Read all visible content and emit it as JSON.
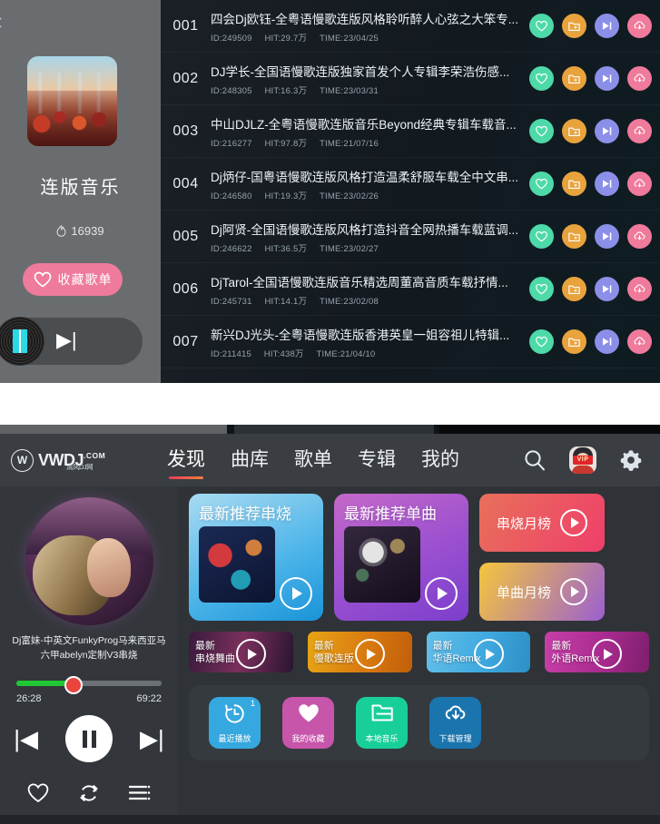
{
  "window1": {
    "back_label": "‹",
    "playlist": {
      "title": "连版音乐",
      "heat_count": "16939",
      "favorite_button": "收藏歌单"
    },
    "tracks": [
      {
        "num": "001",
        "name": "四会Dj欧钰-全粤语慢歌连版风格聆听醉人心弦之大笨专...",
        "id": "ID:249509",
        "hit": "HIT:29.7万",
        "time": "TIME:23/04/25"
      },
      {
        "num": "002",
        "name": "DJ学长-全国语慢歌连版独家首发个人专辑李荣浩伤感...",
        "id": "ID:248305",
        "hit": "HIT:16.3万",
        "time": "TIME:23/03/31"
      },
      {
        "num": "003",
        "name": "中山DJLZ-全粤语慢歌连版音乐Beyond经典专辑车载音...",
        "id": "ID:216277",
        "hit": "HIT:97.8万",
        "time": "TIME:21/07/16"
      },
      {
        "num": "004",
        "name": "Dj炳仔-国粤语慢歌连版风格打造温柔舒服车载全中文串...",
        "id": "ID:246580",
        "hit": "HIT:19.3万",
        "time": "TIME:23/02/26"
      },
      {
        "num": "005",
        "name": "Dj阿贤-全国语慢歌连版风格打造抖音全网热播车载蓝调...",
        "id": "ID:246622",
        "hit": "HIT:36.5万",
        "time": "TIME:23/02/27"
      },
      {
        "num": "006",
        "name": "DjTarol-全国语慢歌连版音乐精选周董高音质车载抒情...",
        "id": "ID:245731",
        "hit": "HIT:14.1万",
        "time": "TIME:23/02/08"
      },
      {
        "num": "007",
        "name": "新兴DJ光头-全粤语慢歌连版香港英皇一姐容祖儿特辑...",
        "id": "ID:211415",
        "hit": "HIT:438万",
        "time": "TIME:21/04/10"
      }
    ],
    "track_action_labels": {
      "favorite": "收藏",
      "add_to_folder": "加入歌单",
      "play_next": "下一首播放",
      "download": "下载"
    }
  },
  "window2": {
    "logo": {
      "mark": "W",
      "text": "VWDJ",
      "com": ".COM",
      "cn": "清风DJ网"
    },
    "tabs": [
      {
        "label": "发现",
        "active": true
      },
      {
        "label": "曲库",
        "active": false
      },
      {
        "label": "歌单",
        "active": false
      },
      {
        "label": "专辑",
        "active": false
      },
      {
        "label": "我的",
        "active": false
      }
    ],
    "nav_icons": {
      "search": "搜索",
      "vip_badge": "VIP",
      "settings": "设置"
    },
    "player": {
      "track_title": "Dj富妹-中英文FunkyProg马来西亚马六甲abelyn定制V3串烧",
      "current_time": "26:28",
      "total_time": "69:22",
      "progress_percent": 38,
      "state": "playing"
    },
    "big_cards": [
      {
        "title": "最新推荐串烧",
        "color": "#49b3e8"
      },
      {
        "title": "最新推荐单曲",
        "color": "#9a4fd0"
      }
    ],
    "rank_cards": [
      {
        "title": "串烧月榜",
        "color": "#ef3f6a"
      },
      {
        "title": "单曲月榜",
        "color": "#f5c63c"
      }
    ],
    "small_cards": [
      {
        "line1": "最新",
        "line2": "串烧舞曲"
      },
      {
        "line1": "最新",
        "line2": "慢歌连版"
      },
      {
        "line1": "最新",
        "line2": "华语Remix"
      },
      {
        "line1": "最新",
        "line2": "外语Remix"
      }
    ],
    "quick_actions": [
      {
        "label": "最近播放",
        "badge": "1",
        "color": "#35a8e0",
        "icon": "history-icon"
      },
      {
        "label": "我的收藏",
        "badge": "",
        "color": "#c755aa",
        "icon": "heart-filled-icon"
      },
      {
        "label": "本地音乐",
        "badge": "",
        "color": "#18cf9a",
        "icon": "folder-icon"
      },
      {
        "label": "下载管理",
        "badge": "",
        "color": "#1a74ad",
        "icon": "download-cloud-icon"
      }
    ]
  },
  "colors": {
    "accent_pink": "#ee7a9c",
    "action_favorite": "#4dd9a8",
    "action_folder": "#e8a33d",
    "action_next": "#8b8fe8",
    "action_download": "#f07a9b",
    "progress_green": "#20c735",
    "tab_underline": "#e83b5a"
  }
}
